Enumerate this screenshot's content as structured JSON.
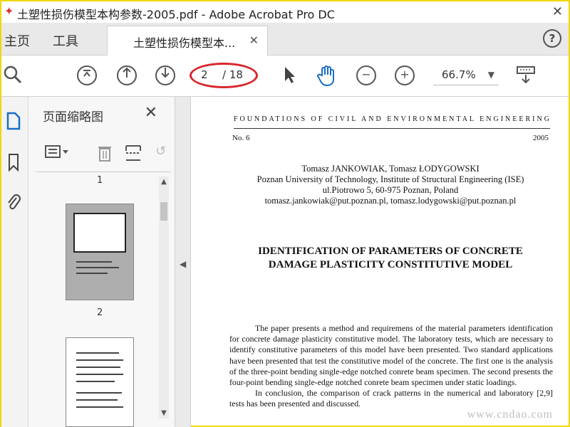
{
  "window": {
    "title": "土塑性损伤模型本构参数-2005.pdf - Adobe Acrobat Pro DC"
  },
  "tabs": {
    "home": "主页",
    "tools": "工具",
    "document_tab": "土塑性损伤模型本...",
    "help": "?"
  },
  "toolbar": {
    "current_page": "2",
    "total_pages": "/ 18",
    "zoom": "66.7%"
  },
  "panel": {
    "title": "页面缩略图",
    "thumb1_label": "1",
    "thumb2_label": "2"
  },
  "document": {
    "journal": "FOUNDATIONS OF CIVIL AND ENVIRONMENTAL ENGINEERING",
    "number": "No. 6",
    "year": "2005",
    "authors": "Tomasz JANKOWIAK, Tomasz ŁODYGOWSKI",
    "affiliation": "Poznan University of Technology, Institute of Structural Engineering (ISE)",
    "address": "ul.Piotrowo 5, 60-975 Poznan, Poland",
    "emails": "tomasz.jankowiak@put.poznan.pl, tomasz.lodygowski@put.poznan.pl",
    "title_line1": "IDENTIFICATION OF PARAMETERS OF CONCRETE",
    "title_line2": "DAMAGE PLASTICITY CONSTITUTIVE MODEL",
    "abstract_p1": "The paper presents a  method and requiremens of  the material parameters identification for concrete damage plasticity constitutive model. The laboratory tests, which are necessary to identify constitutive parameters of this model have been presented. Two standard applications have been presented that test the constitutive model of the concrete. The first one is the analysis of the three-point bending single-edge notched conrete beam specimen. The second presents the four-point bending single-edge notched conrete beam specimen under static loadings.",
    "abstract_p2": "In conclusion, the comparison of crack patterns in the numerical and laboratory [2,9] tests has been presented and discussed."
  },
  "watermark": "www.cndao.com"
}
